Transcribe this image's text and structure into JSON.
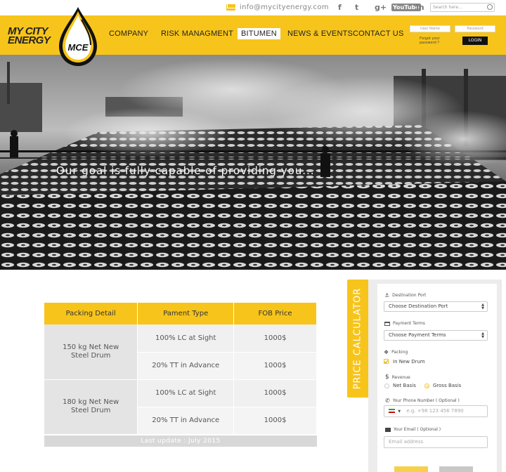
{
  "brand": {
    "name_line1": "MY CITY",
    "name_line2": "ENERGY",
    "emblem_text": "MCE"
  },
  "topbar": {
    "email": "info@mycityenergy.com",
    "social": [
      {
        "icon": "facebook-icon",
        "glyph": "f"
      },
      {
        "icon": "twitter-icon",
        "glyph": "t"
      },
      {
        "icon": "google-plus-icon",
        "glyph": "g+"
      },
      {
        "icon": "youtube-icon",
        "glyph": "YouTube"
      },
      {
        "icon": "linkedin-icon",
        "glyph": "in"
      }
    ],
    "search_placeholder": "Search here..."
  },
  "nav": {
    "items": [
      "COMPANY",
      "RISK MANAGMENT",
      "BITUMEN",
      "NEWS & EVENTS",
      "CONTACT US"
    ],
    "active": "BITUMEN"
  },
  "login": {
    "username_placeholder": "User Name",
    "password_placeholder": "Password",
    "forgot_line1": "Forgot your",
    "forgot_line2": "password ?",
    "button": "LOGIN"
  },
  "hero": {
    "caption": "Our goal is fully capable of providing you..."
  },
  "pricing": {
    "headers": [
      "Packing Detail",
      "Pament Type",
      "FOB Price"
    ],
    "groups": [
      {
        "packing_line1": "150 kg Net New",
        "packing_line2": "Steel Drum",
        "rows": [
          {
            "payment": "100% LC at Sight",
            "price": "1000$"
          },
          {
            "payment": "20% TT in Advance",
            "price": "1000$"
          }
        ]
      },
      {
        "packing_line1": "180 kg Net New",
        "packing_line2": "Steel Drum",
        "rows": [
          {
            "payment": "100% LC at Sight",
            "price": "1000$"
          },
          {
            "payment": "20% TT in Advance",
            "price": "1000$"
          }
        ]
      }
    ],
    "last_update": "Last update : July 2015"
  },
  "calculator": {
    "tab_label": "PRICE CALCULATOR",
    "destination_label": "Destination Port",
    "destination_value": "Choose Destination Port",
    "payment_label": "Payment Terms",
    "payment_value": "Choose Payment Terms",
    "packing_label": "Packing",
    "packing_option": "In New Drum",
    "revenue_label": "Revenue",
    "revenue_options": [
      "Net Basis",
      "Gross Basis"
    ],
    "revenue_selected": "Gross Basis",
    "phone_label": "Your Phone Number ( Optional )",
    "phone_placeholder": "e.g. +98 123 456 7890",
    "email_label": "Your Email ( Optional )",
    "email_placeholder": "Email address"
  },
  "colors": {
    "accent": "#f7c41b",
    "dark": "#222222"
  }
}
